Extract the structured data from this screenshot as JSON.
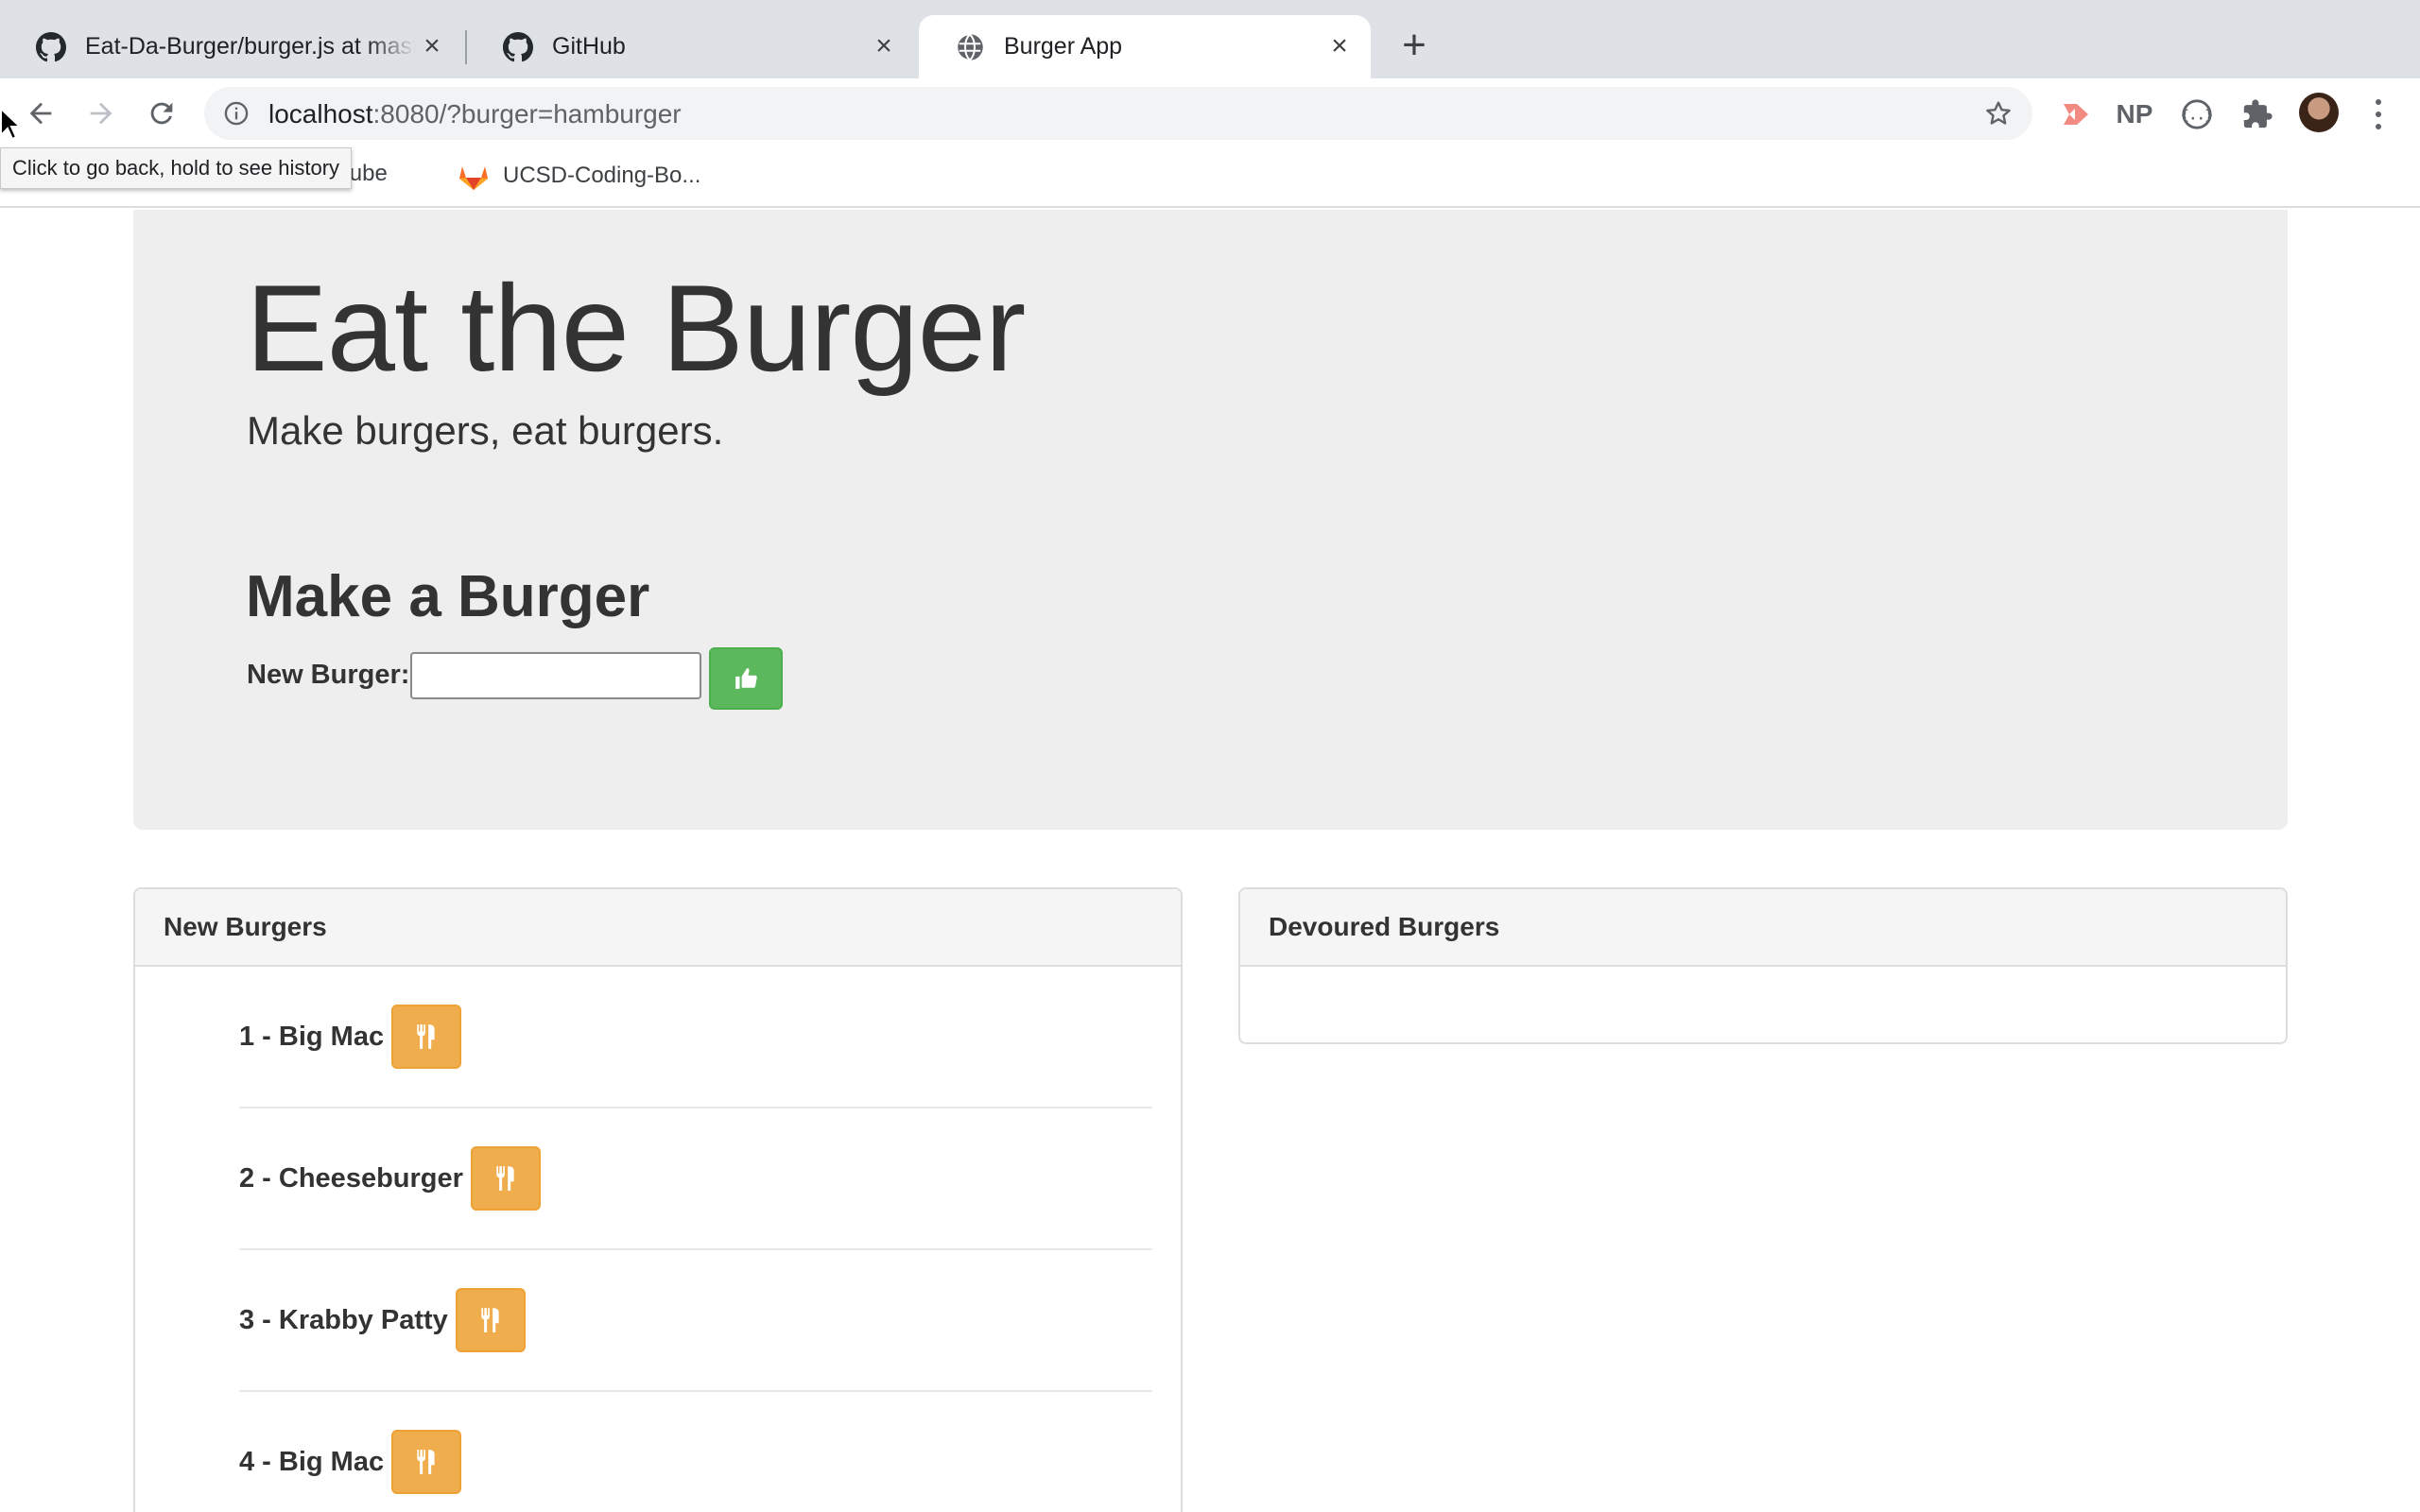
{
  "browser": {
    "tabs": [
      {
        "title": "Eat-Da-Burger/burger.js at master",
        "icon": "github-icon",
        "active": false
      },
      {
        "title": "GitHub",
        "icon": "github-icon",
        "active": false
      },
      {
        "title": "Burger App",
        "icon": "globe-icon",
        "active": true
      }
    ],
    "url_host": "localhost",
    "url_path": ":8080/?burger=hamburger",
    "tooltip": "Click to go back, hold to see history",
    "bookmarks": [
      {
        "label": "Tube",
        "icon": "youtube-icon"
      },
      {
        "label": "UCSD-Coding-Bo...",
        "icon": "gitlab-icon"
      }
    ],
    "extensions": [
      {
        "name": "cast-extension-icon",
        "label": ""
      },
      {
        "name": "np-extension-icon",
        "label": "NP"
      },
      {
        "name": "json-extension-icon",
        "label": ""
      },
      {
        "name": "puzzle-icon",
        "label": ""
      }
    ]
  },
  "page": {
    "title": "Eat the Burger",
    "subtitle": "Make burgers, eat burgers.",
    "form": {
      "heading": "Make a Burger",
      "label": "New Burger:",
      "input_value": "",
      "submit_icon": "thumbs-up-icon"
    },
    "new_burgers": {
      "heading": "New Burgers",
      "items": [
        {
          "text": "1 - Big Mac"
        },
        {
          "text": "2 - Cheeseburger"
        },
        {
          "text": "3 - Krabby Patty"
        },
        {
          "text": "4 - Big Mac"
        },
        {
          "text": ""
        }
      ],
      "button_icon": "cutlery-icon"
    },
    "devoured_burgers": {
      "heading": "Devoured Burgers",
      "items": []
    }
  },
  "colors": {
    "jumbotron_bg": "#eeeeee",
    "success": "#5cb85c",
    "warning": "#f0ad4e",
    "text": "#333333"
  }
}
